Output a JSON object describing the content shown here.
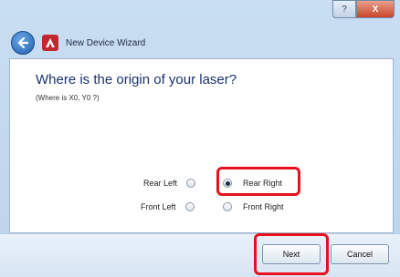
{
  "window": {
    "title": "New Device Wizard",
    "help_glyph": "?",
    "close_glyph": "X"
  },
  "page": {
    "heading": "Where is the origin of your laser?",
    "subheading": "(Where is X0, Y0 ?)"
  },
  "options": {
    "rear_left": {
      "label": "Rear Left",
      "selected": false
    },
    "rear_right": {
      "label": "Rear Right",
      "selected": true
    },
    "front_left": {
      "label": "Front Left",
      "selected": false
    },
    "front_right": {
      "label": "Front Right",
      "selected": false
    }
  },
  "buttons": {
    "next": "Next",
    "cancel": "Cancel"
  },
  "colors": {
    "highlight": "#e8101e",
    "heading": "#1a3170",
    "app_icon": "#c0282d"
  },
  "icons": [
    "back-arrow-icon",
    "app-logo-icon",
    "help-icon",
    "close-icon"
  ]
}
